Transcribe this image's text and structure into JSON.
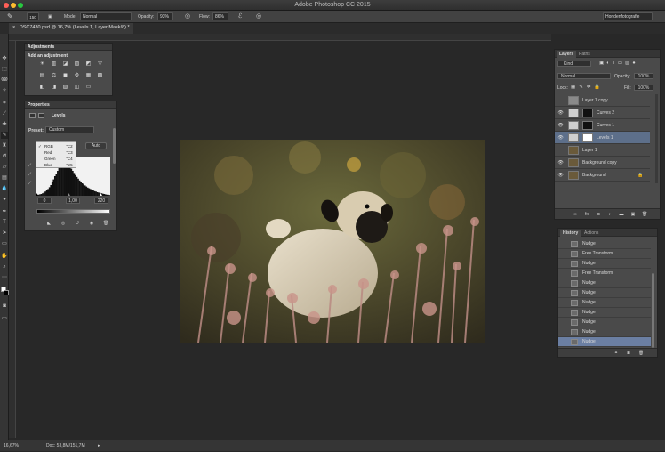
{
  "window": {
    "title": "Adobe Photoshop CC 2015"
  },
  "options_bar": {
    "brush_size": "150",
    "mode_label": "Mode:",
    "mode_value": "Normal",
    "opacity_label": "Opacity:",
    "opacity_value": "93%",
    "flow_label": "Flow:",
    "flow_value": "86%",
    "workspace": "Hondenfotografie"
  },
  "document": {
    "tab": "DSC7430.psd @ 16,7% (Levels 1, Layer Mask/8) *"
  },
  "adjustments": {
    "title": "Adjustments",
    "subtitle": "Add an adjustment",
    "row1": [
      "☀",
      "▥",
      "◪",
      "▨",
      "◩",
      "▽"
    ],
    "row2": [
      "▤",
      "⚖",
      "◼",
      "⚙",
      "▦",
      "▩"
    ],
    "row3": [
      "◧",
      "◨",
      "▧",
      "◫",
      "▭"
    ]
  },
  "properties": {
    "title": "Properties",
    "panel_name": "Levels",
    "preset_label": "Preset:",
    "preset_value": "Custom",
    "auto_label": "Auto",
    "channels": [
      {
        "name": "RGB",
        "shortcut": "⌥2",
        "checked": "✓"
      },
      {
        "name": "Red",
        "shortcut": "⌥3",
        "checked": ""
      },
      {
        "name": "Green",
        "shortcut": "⌥4",
        "checked": ""
      },
      {
        "name": "Blue",
        "shortcut": "⌥5",
        "checked": ""
      }
    ],
    "input_black": "0",
    "input_mid": "1,00",
    "input_white": "220",
    "histogram_levels": [
      0.02,
      0.03,
      0.04,
      0.05,
      0.07,
      0.09,
      0.12,
      0.15,
      0.19,
      0.24,
      0.3,
      0.38,
      0.46,
      0.55,
      0.62,
      0.7,
      0.78,
      0.86,
      0.92,
      0.96,
      1.0,
      0.97,
      0.93,
      0.88,
      0.82,
      0.76,
      0.7,
      0.64,
      0.58,
      0.53,
      0.48,
      0.43,
      0.39,
      0.35,
      0.32,
      0.29,
      0.26,
      0.23,
      0.21,
      0.19,
      0.17,
      0.15,
      0.13,
      0.12,
      0.1,
      0.09,
      0.08,
      0.07,
      0.06,
      0.05,
      0.04,
      0.03,
      0.03,
      0.02
    ]
  },
  "layers_panel": {
    "tabs": [
      "Layers",
      "Paths"
    ],
    "kind_label": "Kind",
    "blend_mode": "Normal",
    "opacity_label": "Opacity:",
    "opacity_value": "100%",
    "lock_label": "Lock:",
    "fill_label": "Fill:",
    "fill_value": "100%",
    "layers": [
      {
        "name": "Layer 1 copy",
        "visible": ""
      },
      {
        "name": "Curves 2",
        "visible": "👁"
      },
      {
        "name": "Curves 1",
        "visible": "👁"
      },
      {
        "name": "Levels 1",
        "visible": "👁"
      },
      {
        "name": "Layer 1",
        "visible": ""
      },
      {
        "name": "Background copy",
        "visible": "👁"
      },
      {
        "name": "Background",
        "visible": "👁"
      }
    ]
  },
  "history_panel": {
    "tabs": [
      "History",
      "Actions"
    ],
    "items": [
      "Nudge",
      "Free Transform",
      "Nudge",
      "Free Transform",
      "Nudge",
      "Nudge",
      "Nudge",
      "Nudge",
      "Nudge",
      "Nudge",
      "Nudge"
    ]
  },
  "status_bar": {
    "zoom": "16,67%",
    "doc_info": "Doc: 53,8M/151,7M"
  },
  "colors": {
    "selected_row": "#5d6f8a",
    "history_selected": "#6b7fa3"
  }
}
